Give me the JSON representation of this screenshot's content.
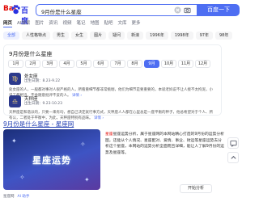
{
  "logo": {
    "bai": "Bai",
    "du": "百度"
  },
  "search": {
    "query": "9月份是什么星座",
    "button": "百度一下"
  },
  "nav": [
    "网页",
    "AI搜索",
    "图片",
    "资讯",
    "视频",
    "笔记",
    "地图",
    "贴吧",
    "文库",
    "更多"
  ],
  "chips": [
    "全部",
    "人性格特点",
    "男生",
    "女生",
    "图片",
    "疑问",
    "新浪",
    "1996年",
    "1998年",
    "97年",
    "98年"
  ],
  "card": {
    "title": "9月份是什么星座",
    "months": [
      "1月",
      "2月",
      "3月",
      "4月",
      "5月",
      "6月",
      "7月",
      "8月",
      "9月",
      "10月",
      "11月",
      "12月"
    ],
    "active_month": "9月",
    "signs": [
      {
        "icon": "♍",
        "name": "处女座",
        "date": "出生日期：8.23-9.22",
        "desc": "处女座的人，一般都对事对人很严格的人，所看重细节都非常挑剔，他们为细节是要重要的，本就老妈说不让人接不太拘泥，小说了都相当，不会随意批评不妥的人。",
        "more": "详情 ›"
      },
      {
        "icon": "♎",
        "name": "天秤座",
        "date": "出生日期：9.23-10.23",
        "desc": "天秤座是和谐派的，只要一来有均，想自己决定就行事方式，天秤座人人都在心里总是一座平衡的秤子，他总希望对于个人、所有公，二者处于平衡中，为此，天秤座特别有品味。",
        "more": "详情 ›"
      }
    ]
  },
  "result2": {
    "title": "9月份是什么星座 - 星座网",
    "image_caption": "星座运势",
    "text_hl": "星座",
    "text": "星座运势分析，属于星座网的本网站精心打造的9月份的运势分析图，还能从个人情况、星座配对、爱情、事业、财运等星座运势去分析这个星座，本网站的运势分析全面而且详细，能让人了解9月份的运势及星座等。",
    "button": "开始分析",
    "source": "星座网",
    "ai_label": "AI 助手"
  }
}
